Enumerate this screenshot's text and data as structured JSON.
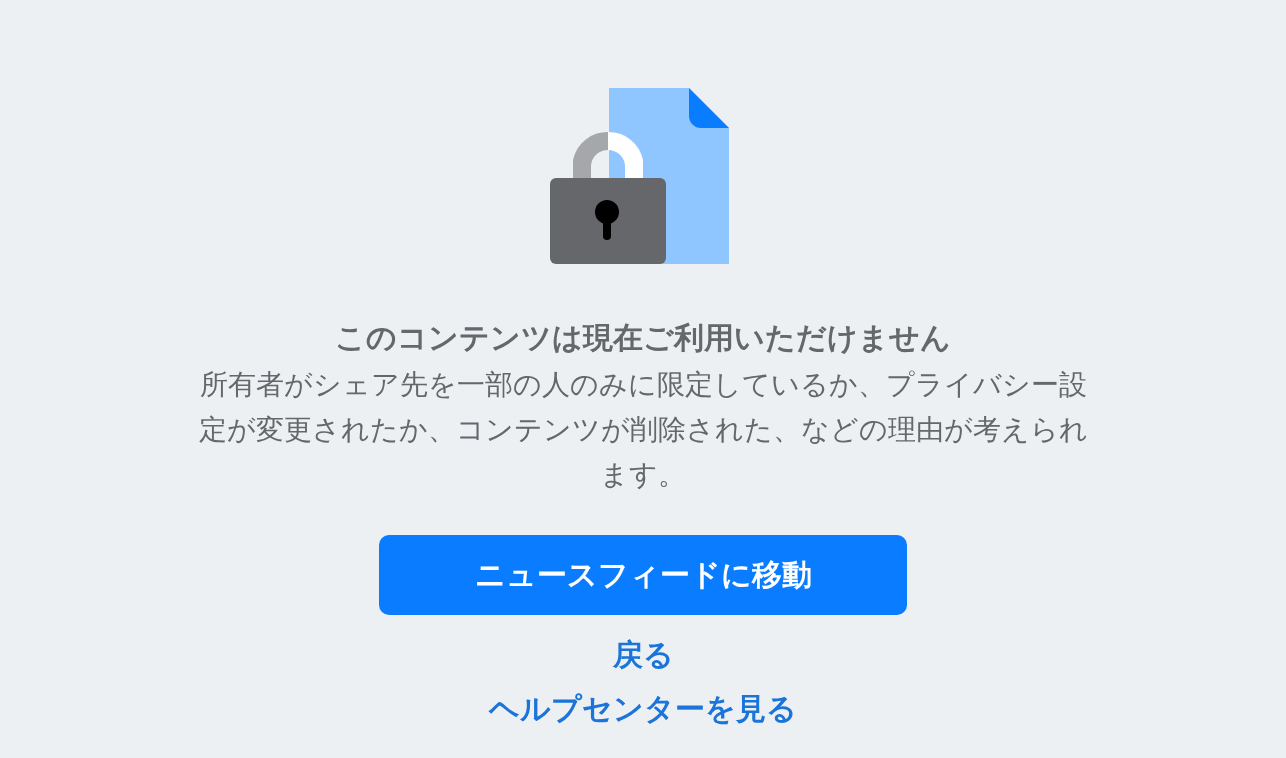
{
  "title": "このコンテンツは現在ご利用いただけません",
  "message": "所有者がシェア先を一部の人のみに限定しているか、プライバシー設定が変更されたか、コンテンツが削除された、などの理由が考えられます。",
  "primary_button": "ニュースフィードに移動",
  "links": [
    "戻る",
    "ヘルプセンターを見る"
  ]
}
